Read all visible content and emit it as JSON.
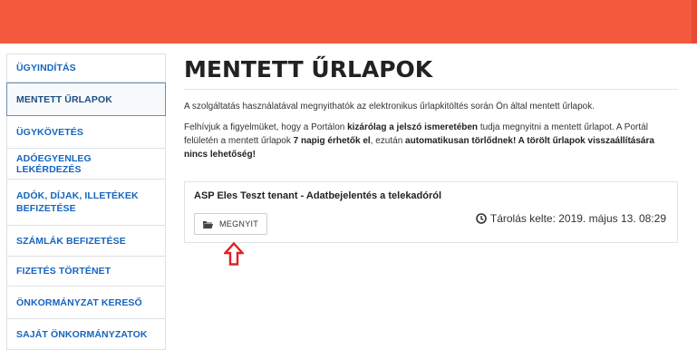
{
  "sidebar": {
    "items": [
      {
        "label": "ÜGYINDÍTÁS",
        "active": false
      },
      {
        "label": "MENTETT ŰRLAPOK",
        "active": true
      },
      {
        "label": "ÜGYKÖVETÉS",
        "active": false
      },
      {
        "label": "ADÓEGYENLEG LEKÉRDEZÉS",
        "active": false
      },
      {
        "label": "ADÓK, DÍJAK, ILLETÉKEK BEFIZETÉSE",
        "active": false
      },
      {
        "label": "SZÁMLÁK BEFIZETÉSE",
        "active": false
      },
      {
        "label": "FIZETÉS TÖRTÉNET",
        "active": false
      },
      {
        "label": "ÖNKORMÁNYZAT KERESŐ",
        "active": false
      },
      {
        "label": "SAJÁT ÖNKORMÁNYZATOK",
        "active": false
      }
    ]
  },
  "main": {
    "title": "MENTETT ŰRLAPOK",
    "intro": "A szolgáltatás használatával megnyithatók az elektronikus űrlapkitöltés során Ön által mentett űrlapok.",
    "notice": {
      "part1": "Felhívjuk a figyelmüket, hogy a Portálon ",
      "bold1": "kizárólag a jelszó ismeretében",
      "part2": " tudja megnyitni a mentett űrlapot. A Portál felületén a mentett űrlapok ",
      "bold2": "7 napig érhetők el",
      "part3": ", ezután ",
      "bold3": "automatikusan törlődnek! A törölt űrlapok visszaállítására nincs lehetőség!"
    },
    "saved_form": {
      "title": "ASP Eles Teszt tenant - Adatbejelentés a telekadóról",
      "open_label": "MEGNYIT",
      "stored_date": "Tárolás kelte: 2019. május 13. 08:29"
    }
  },
  "colors": {
    "topbar": "#f4593d",
    "sidebar_text": "#1565c0",
    "arrow": "#e02020"
  },
  "icons": [
    "folder-open-icon",
    "clock-icon",
    "arrow-up-icon"
  ]
}
